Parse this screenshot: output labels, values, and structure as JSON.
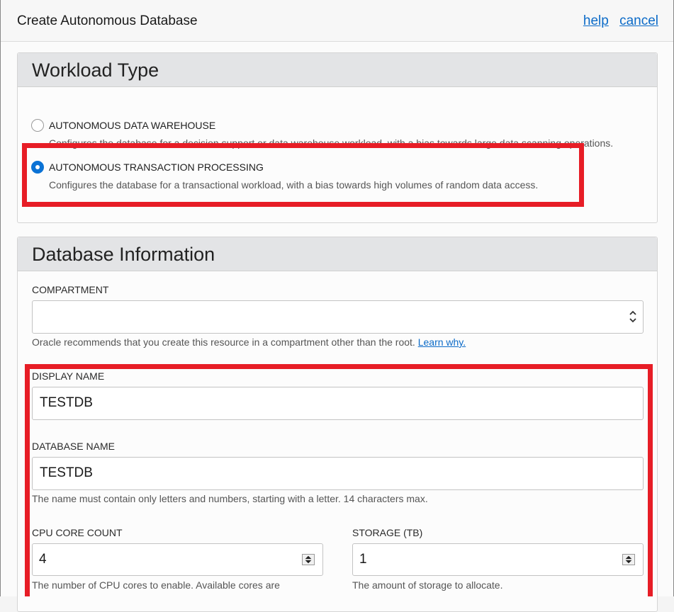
{
  "header": {
    "title": "Create Autonomous Database",
    "help_link": "help",
    "cancel_link": "cancel"
  },
  "workload": {
    "title": "Workload Type",
    "options": [
      {
        "label": "AUTONOMOUS DATA WAREHOUSE",
        "description": "Configures the database for a decision support or data warehouse workload, with a bias towards large data scanning operations.",
        "selected": false
      },
      {
        "label": "AUTONOMOUS TRANSACTION PROCESSING",
        "description": "Configures the database for a transactional workload, with a bias towards high volumes of random data access.",
        "selected": true
      }
    ]
  },
  "dbinfo": {
    "title": "Database Information",
    "compartment": {
      "label": "COMPARTMENT",
      "value": "",
      "help": "Oracle recommends that you create this resource in a compartment other than the root.",
      "help_link": "Learn why."
    },
    "display_name": {
      "label": "DISPLAY NAME",
      "value": "TESTDB"
    },
    "database_name": {
      "label": "DATABASE NAME",
      "value": "TESTDB",
      "help": "The name must contain only letters and numbers, starting with a letter. 14 characters max."
    },
    "cpu": {
      "label": "CPU CORE COUNT",
      "value": "4",
      "help": "The number of CPU cores to enable. Available cores are"
    },
    "storage": {
      "label": "STORAGE (TB)",
      "value": "1",
      "help": "The amount of storage to allocate."
    }
  },
  "colors": {
    "accent": "#0c6bc8",
    "highlight": "#e71d26"
  }
}
